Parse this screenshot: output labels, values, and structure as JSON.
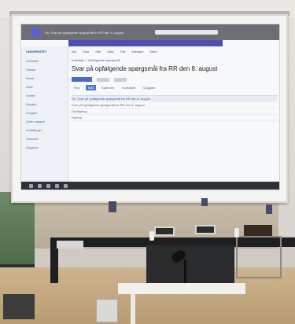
{
  "screen": {
    "window_title": "Re: Svar på opfølgende spørgsmål fra RR den 8. august",
    "sidebar": {
      "logo": "UNIVERSITET",
      "items": [
        "Indbakke",
        "Udkast",
        "Sendt",
        "Arkiv",
        "Slettet",
        "Mapper",
        "Grupper",
        "Delte mapper",
        "Indstillinger",
        "Kalender",
        "Opgaver"
      ]
    },
    "nav": [
      "Nyt",
      "Svar",
      "Slet",
      "Arkiv",
      "Flyt",
      "Kategori",
      "Mere"
    ],
    "breadcrumb": "Indbakke > Opfølgende spørgsmål",
    "heading": "Svar på opfølgende spørgsmål fra RR den 8. august",
    "tabs": [
      "Filer",
      "Mail",
      "Kalender",
      "Kontakter",
      "Opgaver"
    ],
    "rows": [
      "Re: Svar på opfølgende spørgsmål fra RR den 8. august",
      "Svar på opfølgende spørgsmål fra RR den 8. august",
      "Opfølgning",
      "Referat"
    ]
  },
  "colors": {
    "ribbon": "#4c4fb8",
    "sidebar": "#eef1f5",
    "accent": "#5577c6"
  }
}
